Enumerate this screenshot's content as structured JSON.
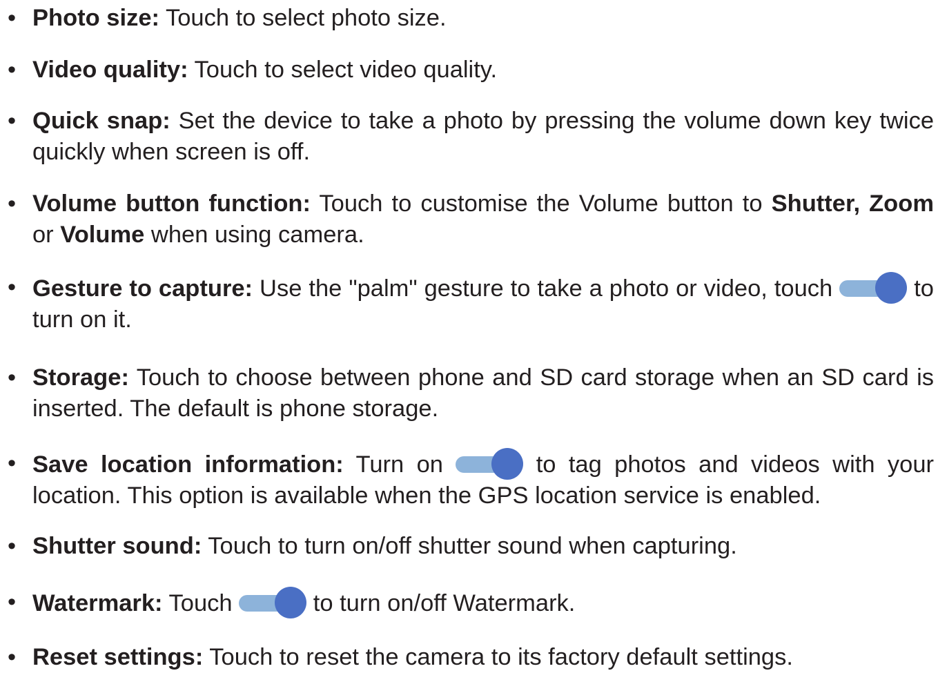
{
  "bullet": "•",
  "toggle_colors": {
    "track": "#8db3da",
    "knob": "#4a6fc4"
  },
  "items": [
    {
      "lead": "Photo size:",
      "text": " Touch to select photo size."
    },
    {
      "lead": "Video quality:",
      "text": " Touch to select video quality."
    },
    {
      "lead": "Quick snap:",
      "text": " Set the device to take a photo by pressing the volume down key twice quickly when screen is off."
    },
    {
      "lead": "Volume button function:",
      "t1": " Touch to customise the Volume button to ",
      "b1": "Shutter, Zoom",
      "t2": " or ",
      "b2": "Volume",
      "t3": " when using camera."
    },
    {
      "lead": "Gesture to capture:",
      "t1": " Use the \"palm\" gesture to take a photo or video, touch ",
      "t2": " to turn on it."
    },
    {
      "lead": "Storage:",
      "text": " Touch to choose between phone and SD card storage when an SD card is inserted. The default is phone storage."
    },
    {
      "lead": "Save location information:",
      "t1": " Turn on ",
      "t2": " to tag photos and videos with your location. This option is available when the GPS location service is enabled."
    },
    {
      "lead": "Shutter sound:",
      "text": " Touch to turn on/off shutter sound when capturing."
    },
    {
      "lead": "Watermark:",
      "t1": " Touch ",
      "t2": " to turn on/off Watermark."
    },
    {
      "lead": "Reset settings:",
      "text": " Touch to reset the camera to its factory default settings."
    }
  ]
}
